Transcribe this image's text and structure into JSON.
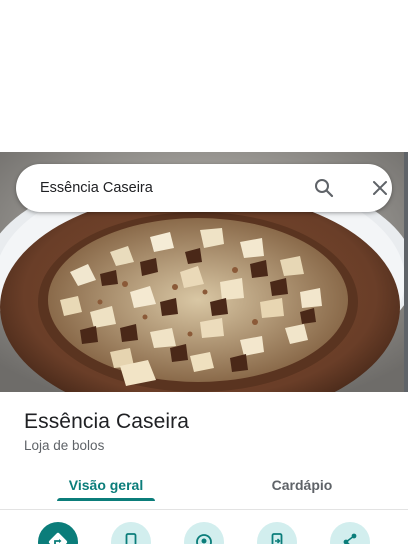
{
  "search": {
    "query": "Essência Caseira"
  },
  "place": {
    "name": "Essência Caseira",
    "category": "Loja de bolos"
  },
  "tabs": [
    {
      "label": "Visão geral",
      "selected": true
    },
    {
      "label": "Cardápio",
      "selected": false
    }
  ],
  "actions": [
    {
      "icon": "directions-icon",
      "primary": true
    },
    {
      "icon": "phone-icon",
      "primary": false
    },
    {
      "icon": "explore-nearby-icon",
      "primary": false
    },
    {
      "icon": "send-to-phone-icon",
      "primary": false
    },
    {
      "icon": "share-icon",
      "primary": false
    }
  ],
  "colors": {
    "accent": "#0b7d7a",
    "action_bg": "#d2eeee",
    "text": "#202124",
    "secondary_text": "#5f6368"
  }
}
